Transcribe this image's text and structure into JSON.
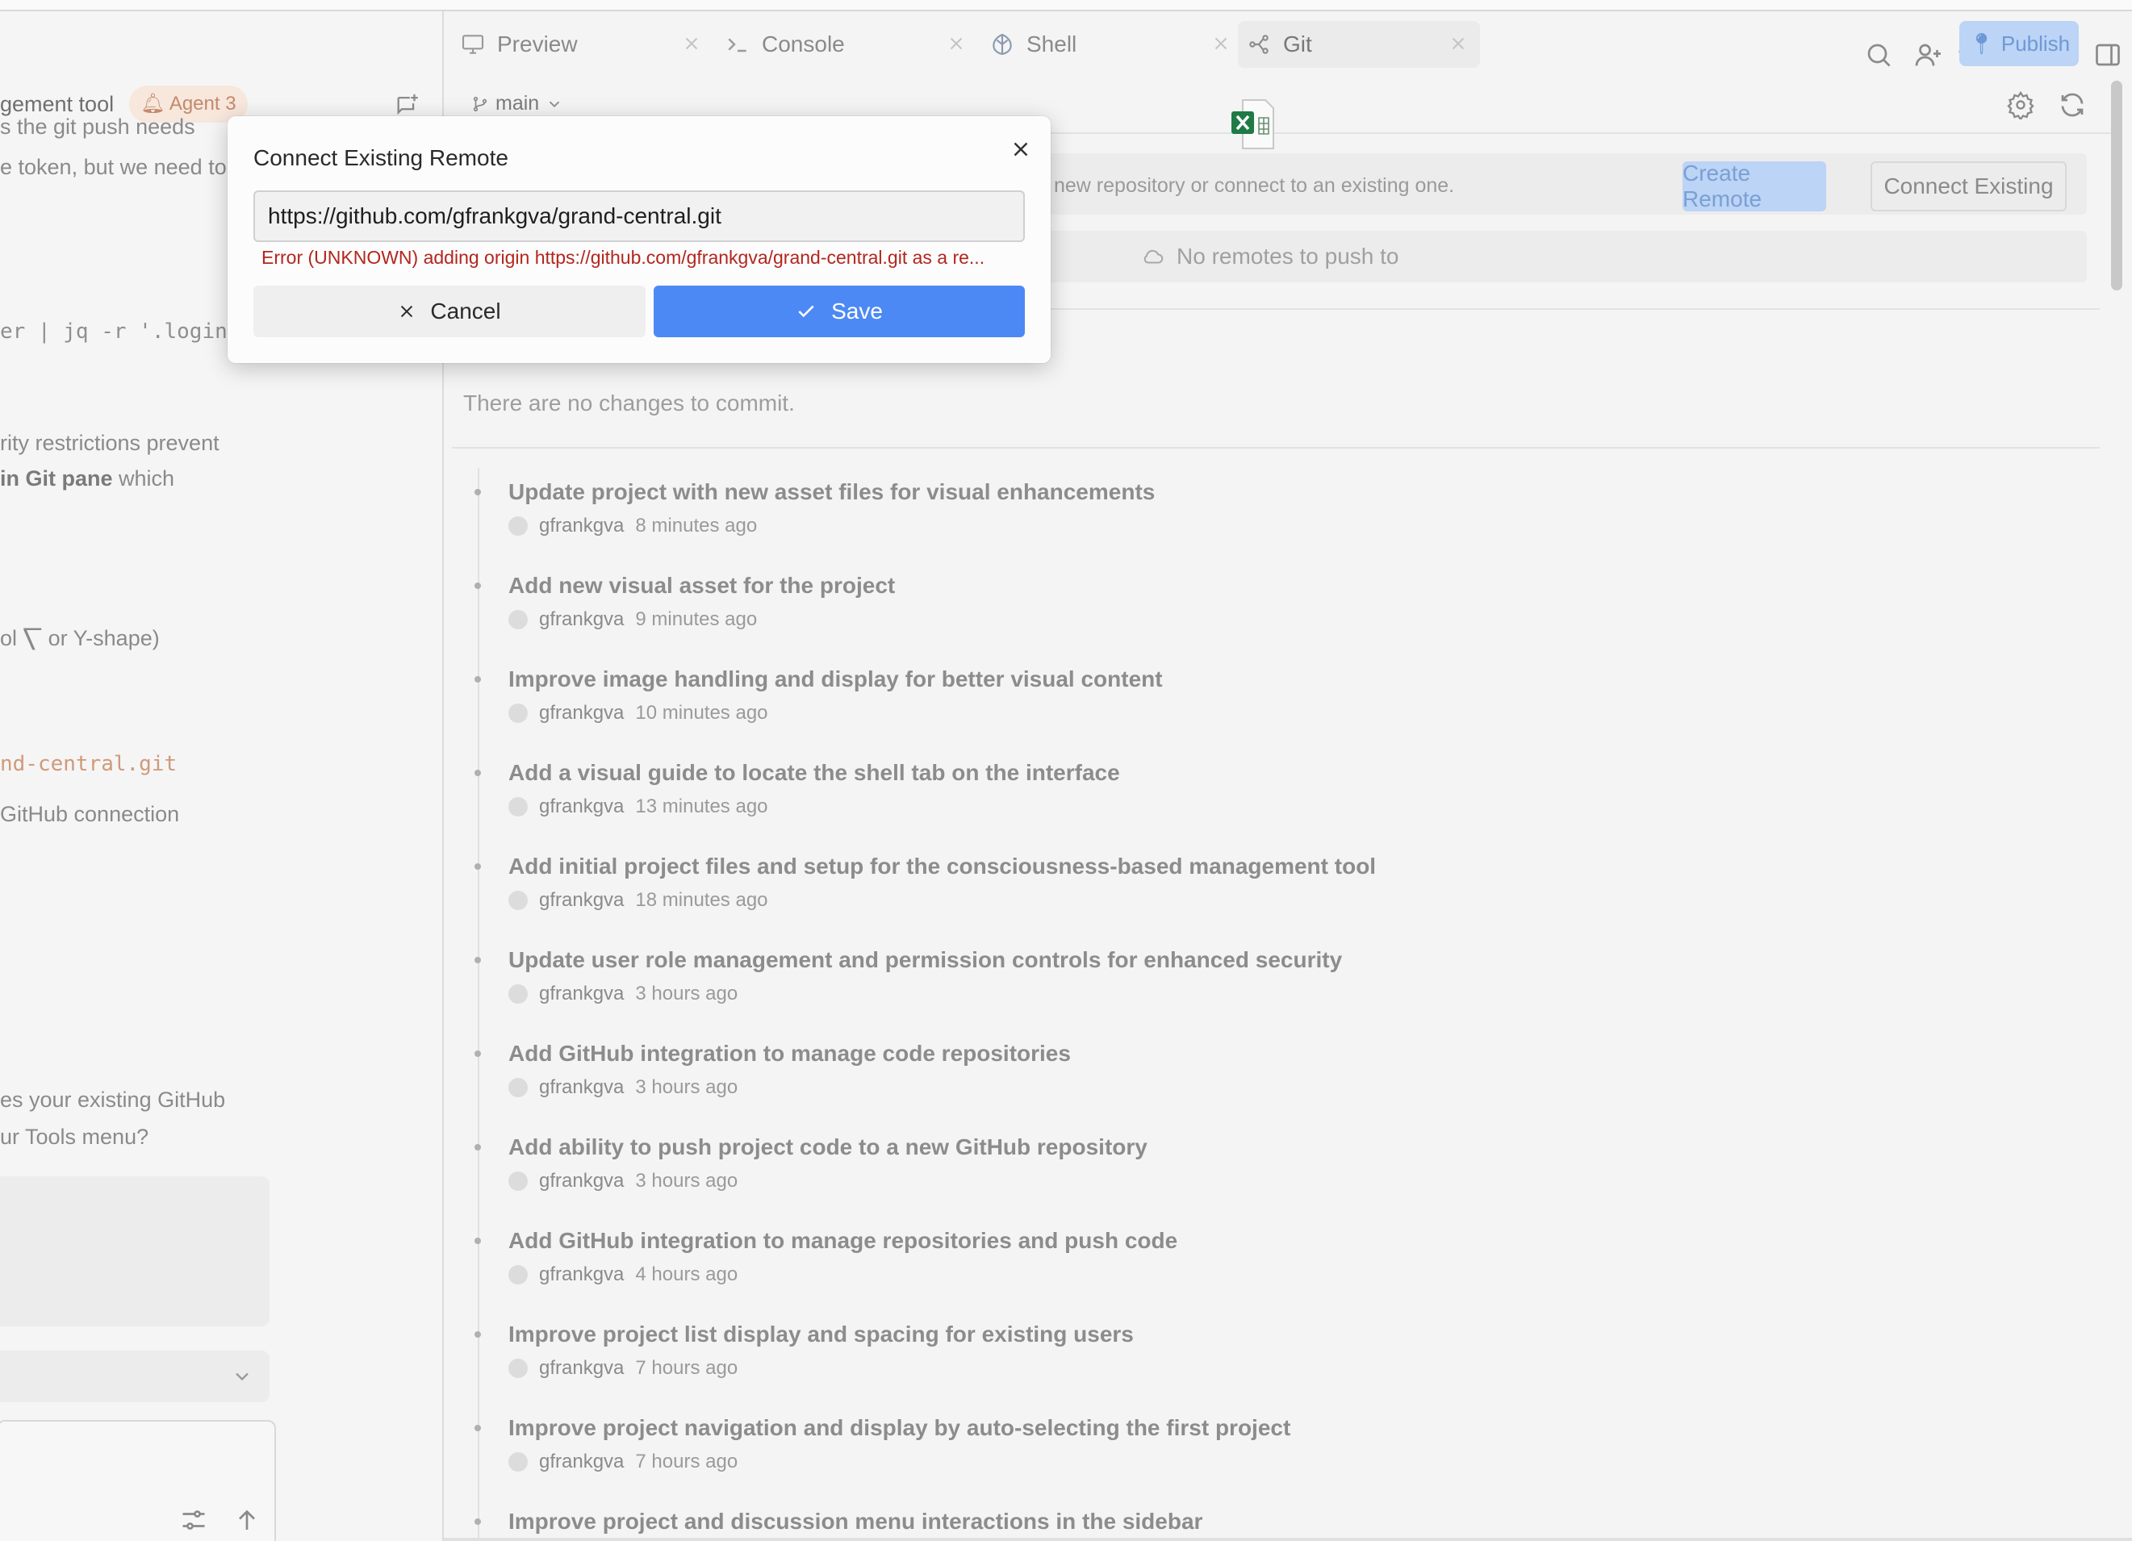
{
  "chat": {
    "title_fragment": "gement tool",
    "agent_badge": "Agent 3",
    "lines": [
      {
        "text": "s the git push needs",
        "style": "plain"
      },
      {
        "text": "e token, but we need to",
        "style": "plain"
      },
      {
        "text": "er | jq -r '.login",
        "style": "mono"
      },
      {
        "text": "rity restrictions prevent",
        "style": "plain"
      },
      {
        "bold": "in Git pane",
        "text": " which",
        "style": "bold-lead"
      },
      {
        "text": "ol ⎲ or Y-shape)",
        "style": "plain"
      },
      {
        "text": "nd-central.git",
        "style": "mono-orange"
      },
      {
        "text": "GitHub connection",
        "style": "plain"
      },
      {
        "text": "es your existing GitHub",
        "style": "plain"
      },
      {
        "text": "ur Tools menu?",
        "style": "plain"
      }
    ]
  },
  "tabs": [
    {
      "label": "Preview",
      "icon": "monitor-icon"
    },
    {
      "label": "Console",
      "icon": "terminal-icon"
    },
    {
      "label": "Shell",
      "icon": "shell-icon"
    },
    {
      "label": "Git",
      "icon": "git-icon",
      "active": true
    }
  ],
  "header": {
    "publish_label": "Publish"
  },
  "git": {
    "branch": "main",
    "remote_message": "new repository or connect to an existing one.",
    "create_remote_label": "Create Remote",
    "connect_existing_label": "Connect Existing",
    "no_remotes_label": "No remotes to push to",
    "no_changes_label": "There are no changes to commit.",
    "commits": [
      {
        "title": "Update project with new asset files for visual enhancements",
        "author": "gfrankgva",
        "time": "8 minutes ago"
      },
      {
        "title": "Add new visual asset for the project",
        "author": "gfrankgva",
        "time": "9 minutes ago"
      },
      {
        "title": "Improve image handling and display for better visual content",
        "author": "gfrankgva",
        "time": "10 minutes ago"
      },
      {
        "title": "Add a visual guide to locate the shell tab on the interface",
        "author": "gfrankgva",
        "time": "13 minutes ago"
      },
      {
        "title": "Add initial project files and setup for the consciousness-based management tool",
        "author": "gfrankgva",
        "time": "18 minutes ago"
      },
      {
        "title": "Update user role management and permission controls for enhanced security",
        "author": "gfrankgva",
        "time": "3 hours ago"
      },
      {
        "title": "Add GitHub integration to manage code repositories",
        "author": "gfrankgva",
        "time": "3 hours ago"
      },
      {
        "title": "Add ability to push project code to a new GitHub repository",
        "author": "gfrankgva",
        "time": "3 hours ago"
      },
      {
        "title": "Add GitHub integration to manage repositories and push code",
        "author": "gfrankgva",
        "time": "4 hours ago"
      },
      {
        "title": "Improve project list display and spacing for existing users",
        "author": "gfrankgva",
        "time": "7 hours ago"
      },
      {
        "title": "Improve project navigation and display by auto-selecting the first project",
        "author": "gfrankgva",
        "time": "7 hours ago"
      },
      {
        "title": "Improve project and discussion menu interactions in the sidebar",
        "author": "",
        "time": ""
      }
    ]
  },
  "modal": {
    "title": "Connect Existing Remote",
    "input_value": "https://github.com/gfrankgva/grand-central.git",
    "error": "Error (UNKNOWN) adding origin https://github.com/gfrankgva/grand-central.git as a re...",
    "cancel_label": "Cancel",
    "save_label": "Save"
  },
  "colors": {
    "accent": "#4d89f5",
    "error": "#b3261e",
    "agent_badge_bg": "#f7e7dc"
  }
}
